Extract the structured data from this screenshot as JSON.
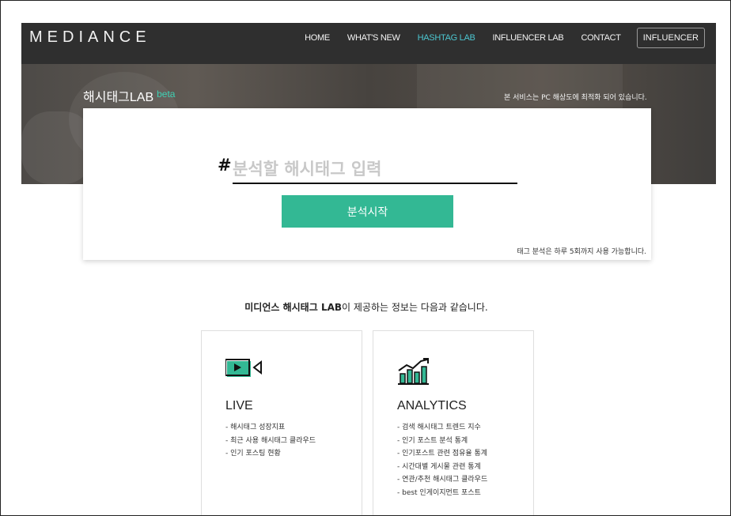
{
  "nav": {
    "logo": "MEDIANCE",
    "items": [
      {
        "label": "HOME",
        "active": false
      },
      {
        "label": "WHAT'S NEW",
        "active": false
      },
      {
        "label": "HASHTAG LAB",
        "active": true
      },
      {
        "label": "INFLUENCER LAB",
        "active": false
      },
      {
        "label": "CONTACT",
        "active": false
      }
    ],
    "button": "INFLUENCER",
    "active_color": "#4cc6d0"
  },
  "banner": {
    "title": "해시태그LAB",
    "badge": "beta",
    "notice": "본 서비스는 PC 해상도에 최적화 되어 있습니다."
  },
  "search": {
    "prefix": "#",
    "placeholder": "분석할 해시태그 입력",
    "value": "",
    "button": "분석시작",
    "button_color": "#33b894",
    "limit_note": "태그 분석은 하루 5회까지 사용 가능합니다."
  },
  "intro": {
    "brand": "미디언스 해시태그 LAB",
    "text": "이 제공하는 정보는 다음과 같습니다."
  },
  "features": [
    {
      "icon": "video-icon",
      "title": "LIVE",
      "items": [
        "- 해시태그 성장지표",
        "- 최근 사용 해시태그 클라우드",
        "- 인기 포스팅 현황"
      ]
    },
    {
      "icon": "analytics-chart-icon",
      "title": "ANALYTICS",
      "items": [
        "- 검색 해시태그 트렌드 지수",
        "- 인기 포스트 분석 통계",
        "- 인기포스트 관련 점유율 통계",
        "- 시간대별 게시물 관련 통계",
        "- 연관/추천 해시태그 클라우드",
        "- best 인게이지먼트 포스트"
      ]
    }
  ]
}
